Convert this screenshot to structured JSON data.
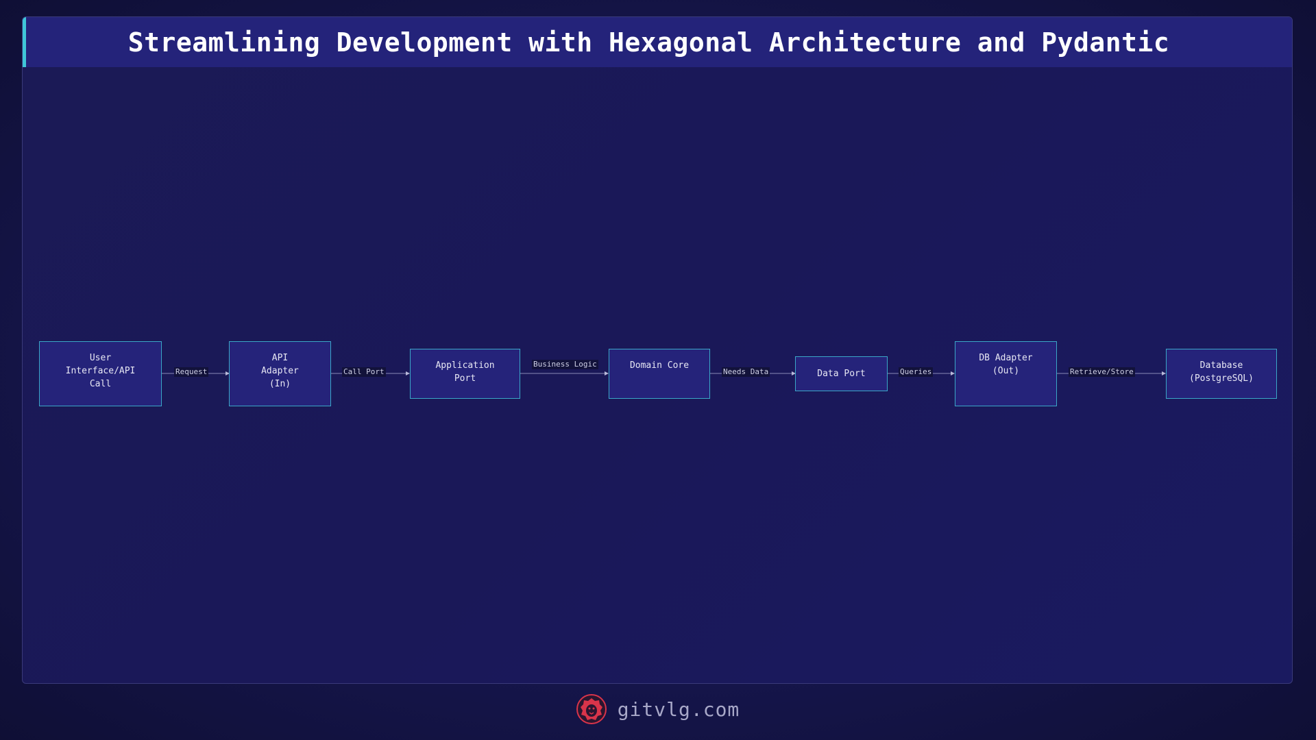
{
  "header": {
    "title": "Streamlining Development with Hexagonal Architecture and Pydantic"
  },
  "diagram": {
    "nodes": [
      {
        "id": "user",
        "label": "User\nInterface/API\nCall"
      },
      {
        "id": "api-adapter",
        "label": "API\nAdapter\n(In)"
      },
      {
        "id": "app-port",
        "label": "Application\nPort"
      },
      {
        "id": "domain-core",
        "label": "Domain Core"
      },
      {
        "id": "data-port",
        "label": "Data Port"
      },
      {
        "id": "db-adapter",
        "label": "DB Adapter\n(Out)"
      },
      {
        "id": "database",
        "label": "Database\n(PostgreSQL)"
      }
    ],
    "edges": [
      {
        "from": "user",
        "to": "api-adapter",
        "label": "Request"
      },
      {
        "from": "api-adapter",
        "to": "app-port",
        "label": "Call Port"
      },
      {
        "from": "app-port",
        "to": "domain-core",
        "label": "Business Logic"
      },
      {
        "from": "domain-core",
        "to": "data-port",
        "label": "Needs Data"
      },
      {
        "from": "data-port",
        "to": "db-adapter",
        "label": "Queries"
      },
      {
        "from": "db-adapter",
        "to": "database",
        "label": "Retrieve/Store"
      }
    ]
  },
  "footer": {
    "site": "gitvlg.com",
    "logo_icon": "lion-head-icon"
  },
  "colors": {
    "accent": "#3fc6d8",
    "node_fill": "#25237a",
    "node_border": "#3aa8c8",
    "title_bar": "#24237a",
    "logo": "#d9344a"
  }
}
